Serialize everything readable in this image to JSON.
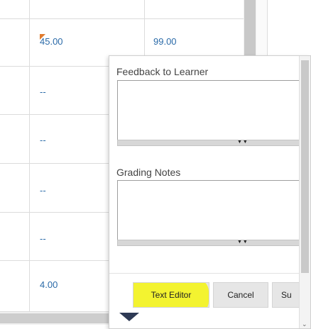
{
  "grid": {
    "rows": [
      {
        "score": "45.00",
        "max": "99.00",
        "flagged": true
      },
      {
        "score": "--",
        "max": ""
      },
      {
        "score": "--",
        "max": ""
      },
      {
        "score": "--",
        "max": ""
      },
      {
        "score": "--",
        "max": ""
      },
      {
        "score": "4.00",
        "max": ""
      }
    ]
  },
  "popup": {
    "feedback_label": "Feedback to Learner",
    "feedback_value": "",
    "notes_label": "Grading Notes",
    "notes_value": "",
    "grip_glyph": "▼▼",
    "buttons": {
      "text_editor": "Text Editor",
      "cancel": "Cancel",
      "submit_partial": "Su"
    },
    "scroll_arrow": "⌄"
  },
  "colors": {
    "link_value": "#2a6aa8",
    "highlight": "#f4f41c",
    "flag": "#e07b2d",
    "caret": "#2e3a55"
  }
}
